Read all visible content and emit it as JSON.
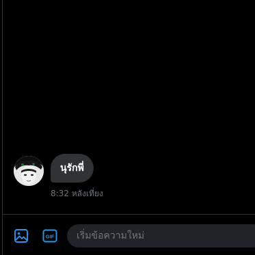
{
  "conversation": {
    "messages": [
      {
        "text": "นุรักพี่",
        "time": "8:32 หลังเที่ยง"
      }
    ]
  },
  "composer": {
    "placeholder": "เริ่มข้อความใหม่",
    "media_icon": "image-icon",
    "gif_icon": "gif-icon",
    "gif_label": "GIF"
  },
  "colors": {
    "background": "#000000",
    "bubble": "#2f3336",
    "accent": "#1d9bf0",
    "muted_text": "#71767b",
    "input_bg": "#202327"
  }
}
